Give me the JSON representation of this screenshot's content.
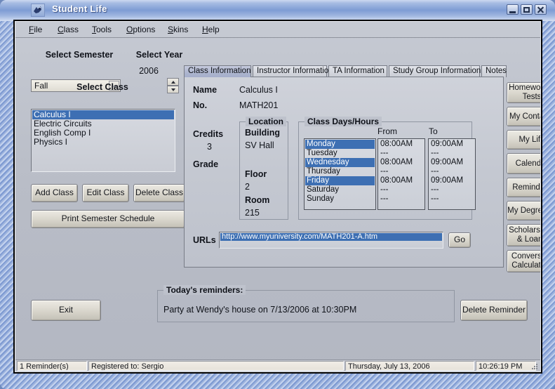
{
  "window": {
    "title": "Student Life",
    "minimize_label": "Minimize",
    "maximize_label": "Maximize",
    "close_label": "Close"
  },
  "menu": {
    "items": [
      {
        "label": "File",
        "accel": "F"
      },
      {
        "label": "Class",
        "accel": "C"
      },
      {
        "label": "Tools",
        "accel": "T"
      },
      {
        "label": "Options",
        "accel": "O"
      },
      {
        "label": "Skins",
        "accel": "S"
      },
      {
        "label": "Help",
        "accel": "H"
      }
    ]
  },
  "left_panel": {
    "semester_label": "Select Semester",
    "semester_value": "Fall",
    "year_label": "Select Year",
    "year_value": "2006",
    "class_label": "Select Class",
    "classes": [
      "Calculus I",
      "Electric Circuits",
      "English Comp I",
      "Physics I"
    ],
    "selected_class_index": 0,
    "buttons": {
      "add": "Add Class",
      "edit": "Edit Class",
      "delete": "Delete Class",
      "print": "Print Semester Schedule"
    }
  },
  "tabs": {
    "items": [
      "Class Information",
      "Instructor Information",
      "TA Information",
      "Study Group Information",
      "Notes"
    ],
    "active_index": 0
  },
  "class_info": {
    "name_label": "Name",
    "name_value": "Calculus I",
    "no_label": "No.",
    "no_value": "MATH201",
    "credits_label": "Credits",
    "credits_value": "3",
    "grade_label": "Grade",
    "grade_value": "",
    "location": {
      "caption": "Location",
      "building_label": "Building",
      "building_value": "SV Hall",
      "floor_label": "Floor",
      "floor_value": "2",
      "room_label": "Room",
      "room_value": "215"
    },
    "schedule": {
      "caption": "Class Days/Hours",
      "col_from": "From",
      "col_to": "To",
      "rows": [
        {
          "day": "Monday",
          "from": "08:00AM",
          "to": "09:00AM",
          "selected": true
        },
        {
          "day": "Tuesday",
          "from": "---",
          "to": "---",
          "selected": false
        },
        {
          "day": "Wednesday",
          "from": "08:00AM",
          "to": "09:00AM",
          "selected": true
        },
        {
          "day": "Thursday",
          "from": "---",
          "to": "---",
          "selected": false
        },
        {
          "day": "Friday",
          "from": "08:00AM",
          "to": "09:00AM",
          "selected": true
        },
        {
          "day": "Saturday",
          "from": "---",
          "to": "---",
          "selected": false
        },
        {
          "day": "Sunday",
          "from": "---",
          "to": "---",
          "selected": false
        }
      ]
    },
    "urls_label": "URLs",
    "url_value": "http://www.myuniversity.com/MATH201-A.htm",
    "url_value_2": "",
    "go_label": "Go"
  },
  "right_bar": {
    "buttons": [
      "Homework & Tests",
      "My Contacts",
      "My Life",
      "Calendar",
      "Reminders",
      "My Degree(s)",
      "Scholarships & Loans",
      "Conversion Calculators"
    ]
  },
  "bottom": {
    "exit_label": "Exit",
    "reminders_caption": "Today's reminders:",
    "reminder_text": "Party at Wendy's house on 7/13/2006 at 10:30PM",
    "delete_reminder_label": "Delete Reminder"
  },
  "statusbar": {
    "reminders_count": "1 Reminder(s)",
    "registered_to": "Registered to: Sergio",
    "date": "Thursday, July 13, 2006",
    "time": "10:26:19 PM"
  },
  "colors": {
    "selection_blue": "#3d6fb3",
    "window_bg": "#bfc3cd",
    "frame_blue": "#7e9cd4",
    "title_text": "#ffffff"
  }
}
